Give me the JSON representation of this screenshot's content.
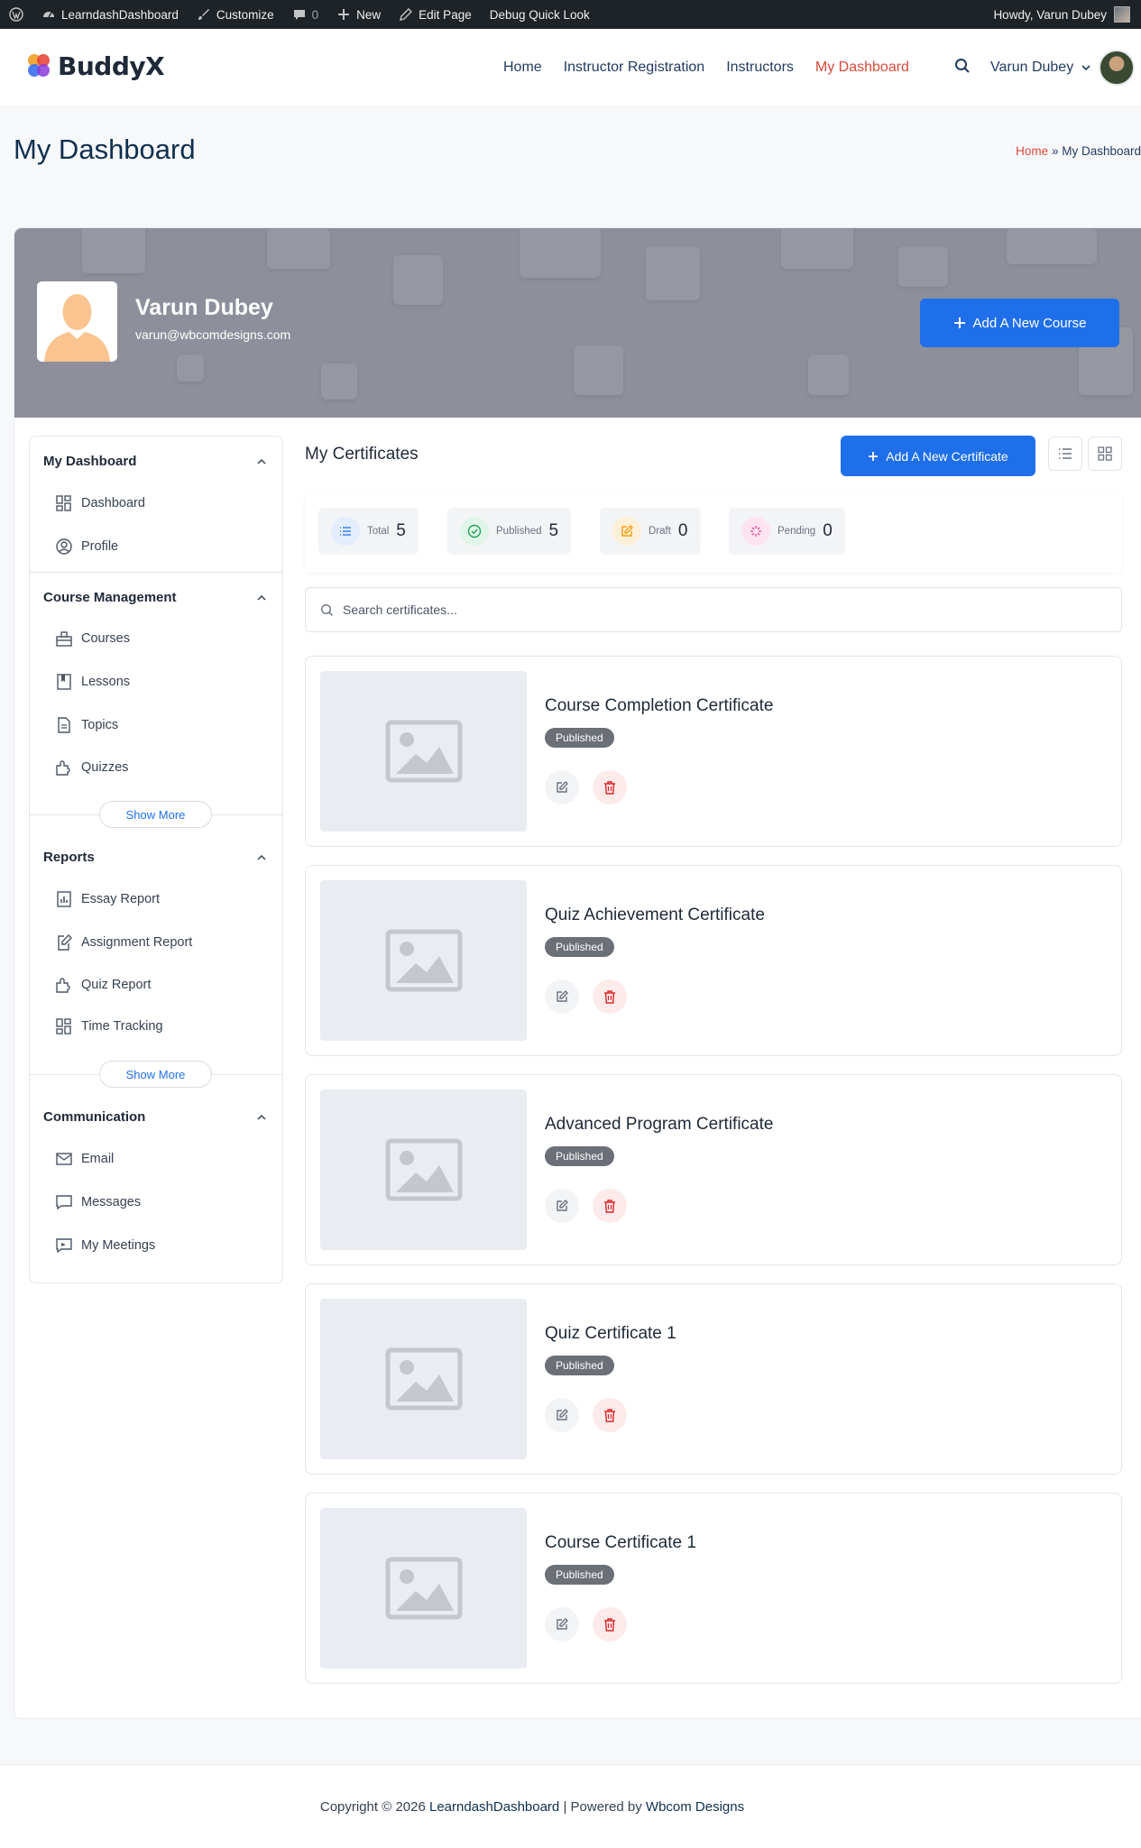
{
  "admin_bar": {
    "site_name": "LearndashDashboard",
    "customize": "Customize",
    "comments_count": "0",
    "new": "New",
    "edit_page": "Edit Page",
    "debug": "Debug Quick Look",
    "howdy": "Howdy, Varun Dubey"
  },
  "header": {
    "logo_text": "BuddyX",
    "nav": [
      {
        "label": "Home"
      },
      {
        "label": "Instructor Registration"
      },
      {
        "label": "Instructors"
      },
      {
        "label": "My Dashboard"
      }
    ],
    "user_name": "Varun Dubey"
  },
  "page": {
    "title": "My Dashboard",
    "breadcrumb_home": "Home",
    "breadcrumb_sep": " » ",
    "breadcrumb_current": "My Dashboard"
  },
  "profile": {
    "name": "Varun Dubey",
    "email": "varun@wbcomdesigns.com",
    "add_course_label": "Add A New Course"
  },
  "sidebar": {
    "sections": [
      {
        "title": "My Dashboard",
        "items": [
          {
            "label": "Dashboard",
            "icon": "grid-icon"
          },
          {
            "label": "Profile",
            "icon": "user-circle-icon"
          }
        ]
      },
      {
        "title": "Course Management",
        "items": [
          {
            "label": "Courses",
            "icon": "courses-icon"
          },
          {
            "label": "Lessons",
            "icon": "bookmark-icon"
          },
          {
            "label": "Topics",
            "icon": "document-icon"
          },
          {
            "label": "Quizzes",
            "icon": "puzzle-icon"
          }
        ],
        "show_more": "Show More"
      },
      {
        "title": "Reports",
        "items": [
          {
            "label": "Essay Report",
            "icon": "chart-icon"
          },
          {
            "label": "Assignment Report",
            "icon": "edit-doc-icon"
          },
          {
            "label": "Quiz Report",
            "icon": "puzzle-icon"
          },
          {
            "label": "Time Tracking",
            "icon": "grid-icon"
          }
        ],
        "show_more": "Show More"
      },
      {
        "title": "Communication",
        "items": [
          {
            "label": "Email",
            "icon": "mail-icon"
          },
          {
            "label": "Messages",
            "icon": "message-icon"
          },
          {
            "label": "My Meetings",
            "icon": "meeting-icon"
          }
        ]
      }
    ]
  },
  "certificates": {
    "section_title": "My Certificates",
    "add_label": "Add A New Certificate",
    "stats": [
      {
        "label": "Total",
        "value": "5",
        "color": "#3b82f6"
      },
      {
        "label": "Published",
        "value": "5",
        "color": "#22a35a"
      },
      {
        "label": "Draft",
        "value": "0",
        "color": "#f59e0b"
      },
      {
        "label": "Pending",
        "value": "0",
        "color": "#ec4899"
      }
    ],
    "search_placeholder": "Search certificates...",
    "items": [
      {
        "title": "Course Completion Certificate",
        "status": "Published"
      },
      {
        "title": "Quiz Achievement Certificate",
        "status": "Published"
      },
      {
        "title": "Advanced Program Certificate",
        "status": "Published"
      },
      {
        "title": "Quiz Certificate 1",
        "status": "Published"
      },
      {
        "title": "Course Certificate 1",
        "status": "Published"
      }
    ]
  },
  "footer": {
    "prefix": "Copyright © 2026 ",
    "site_link": "LearndashDashboard",
    "middle": " | Powered by ",
    "company_link": "Wbcom Designs"
  },
  "colors": {
    "accent": "#1f6feb",
    "active_nav": "#d94a3a",
    "delete": "#dc2626"
  }
}
